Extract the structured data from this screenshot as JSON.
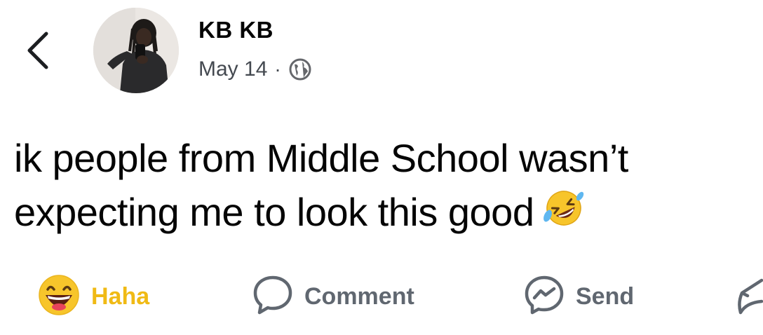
{
  "post": {
    "author": "KB KB",
    "date": "May 14",
    "separator": "·",
    "privacy_icon": "globe-icon",
    "text_line1": "ik people from Middle School wasn’t",
    "text_line2": "expecting me to look this good",
    "emoji": "rolling-on-floor-laughing-emoji"
  },
  "actions": {
    "reaction_label": "Haha",
    "reaction_icon": "haha-emoji-icon",
    "reaction_color": "#f0ba15",
    "comment_label": "Comment",
    "comment_icon": "comment-bubble-icon",
    "send_label": "Send",
    "send_icon": "messenger-icon",
    "share_icon": "share-icon"
  },
  "nav": {
    "back_icon": "chevron-left-icon"
  }
}
